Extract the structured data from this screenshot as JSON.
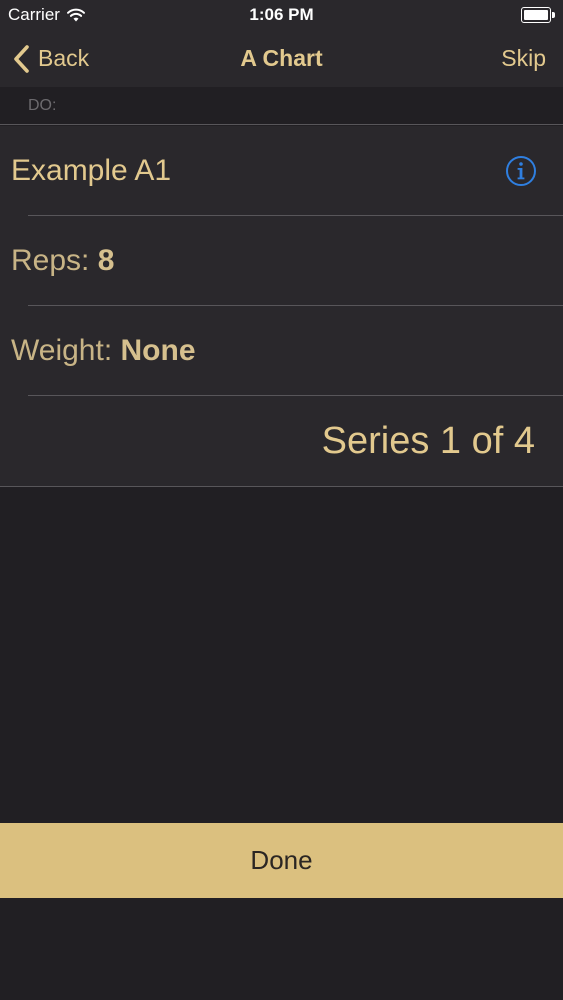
{
  "status_bar": {
    "carrier": "Carrier",
    "time": "1:06 PM",
    "wifi_icon": "wifi-icon",
    "battery_icon": "battery-icon"
  },
  "nav": {
    "back_label": "Back",
    "title": "A Chart",
    "skip_label": "Skip"
  },
  "section": {
    "header": "DO:"
  },
  "rows": {
    "exercise_name": "Example A1",
    "reps_label": "Reps: ",
    "reps_value": "8",
    "weight_label": "Weight: ",
    "weight_value": "None",
    "series_text": "Series 1 of 4"
  },
  "done_label": "Done",
  "colors": {
    "accent": "#e2c98e",
    "background": "#211f23",
    "cell_background": "#2a282c",
    "done_button": "#dbc07f",
    "info_icon": "#2f7fe0"
  }
}
